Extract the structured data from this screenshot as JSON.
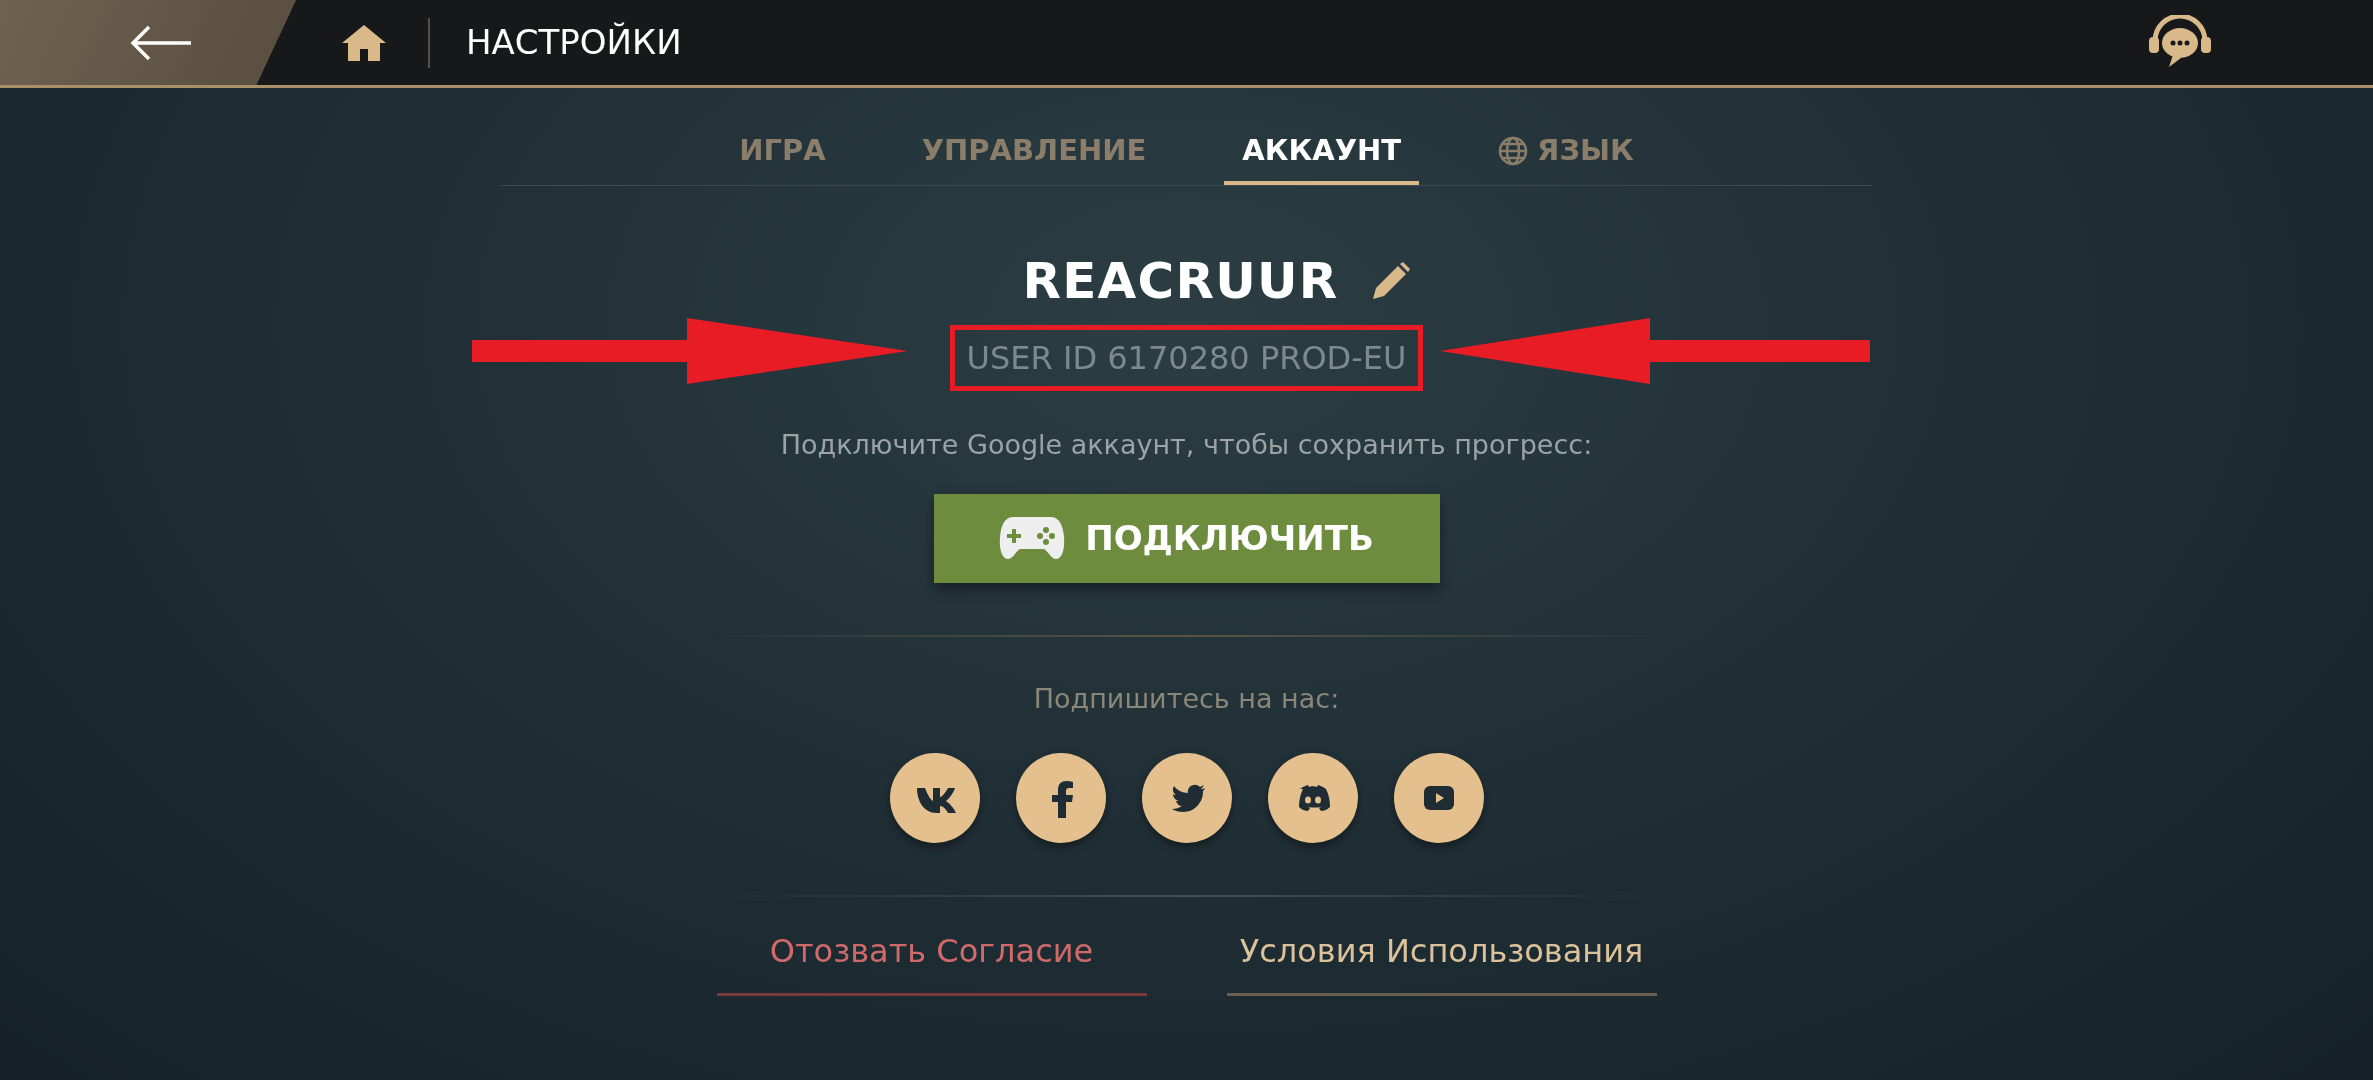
{
  "header": {
    "title": "НАСТРОЙКИ"
  },
  "tabs": [
    {
      "label": "ИГРА",
      "selected": false,
      "kind": "text"
    },
    {
      "label": "УПРАВЛЕНИЕ",
      "selected": false,
      "kind": "text"
    },
    {
      "label": "АККАУНТ",
      "selected": true,
      "kind": "text"
    },
    {
      "label": "ЯЗЫК",
      "selected": false,
      "kind": "globe"
    }
  ],
  "account": {
    "username": "REACRUUR",
    "user_id": "USER ID 6170280 PROD-EU",
    "highlighted": true,
    "connect_prompt": "Подключите Google аккаунт, чтобы сохранить прогресс:",
    "connect_button": "ПОДКЛЮЧИТЬ"
  },
  "social": {
    "title": "Подпишитесь на нас:",
    "links": [
      {
        "kind": "vk"
      },
      {
        "kind": "facebook"
      },
      {
        "kind": "twitter"
      },
      {
        "kind": "discord"
      },
      {
        "kind": "youtube"
      }
    ]
  },
  "footer_links": [
    {
      "label": "Отозвать Согласие",
      "kind": "warning"
    },
    {
      "label": "Условия Использования",
      "kind": "normal"
    }
  ]
}
